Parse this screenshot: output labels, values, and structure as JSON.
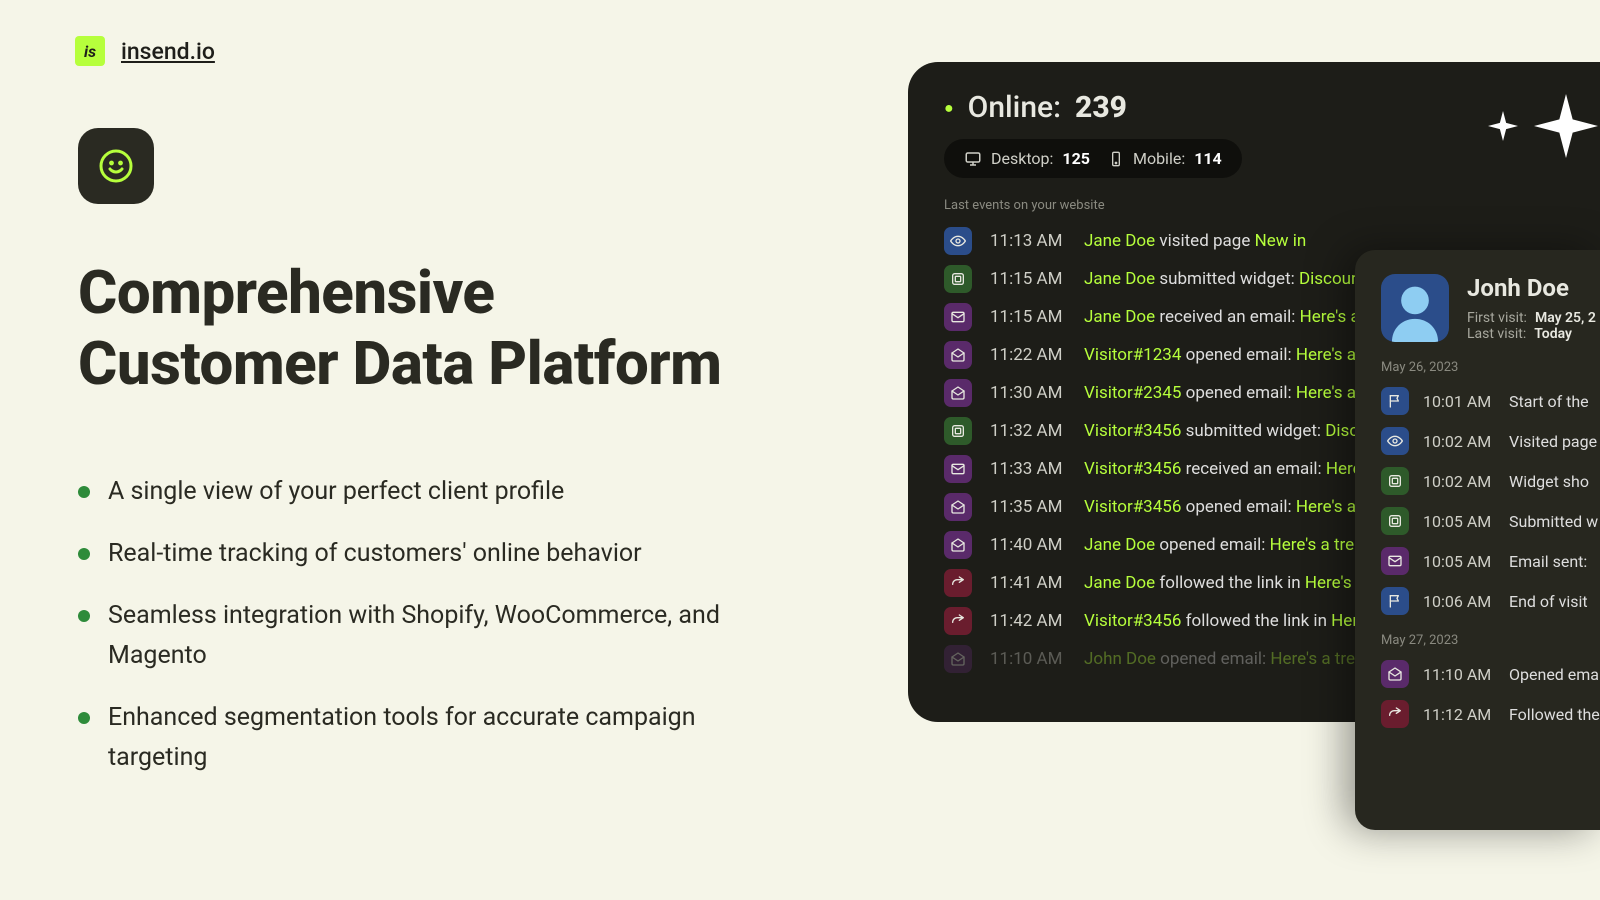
{
  "brand": {
    "logo_text": "is",
    "name": "insend.io"
  },
  "hero": {
    "title_line1": "Comprehensive",
    "title_line2": "Customer Data Platform",
    "bullets": [
      "A single view of your perfect client profile",
      "Real-time tracking of customers' online behavior",
      "Seamless integration with Shopify, WooCommerce, and Magento",
      "Enhanced segmentation tools for accurate campaign targeting"
    ]
  },
  "dashboard": {
    "online_label": "Online:",
    "online_count": "239",
    "device": {
      "desktop_label": "Desktop:",
      "desktop_count": "125",
      "mobile_label": "Mobile:",
      "mobile_count": "114"
    },
    "last_events_label": "Last events on your website",
    "events": [
      {
        "icon": "eye",
        "color": "blue",
        "time": "11:13 AM",
        "who": "Jane Doe",
        "verb": "visited page",
        "obj": "New in"
      },
      {
        "icon": "widget",
        "color": "green",
        "time": "11:15 AM",
        "who": "Jane Doe",
        "verb": "submitted widget:",
        "obj": "Discount"
      },
      {
        "icon": "mail",
        "color": "purple",
        "time": "11:15 AM",
        "who": "Jane Doe",
        "verb": "received an email:",
        "obj": "Here's a"
      },
      {
        "icon": "mailopen",
        "color": "purple",
        "time": "11:22 AM",
        "who": "Visitor#1234",
        "verb": "opened email:",
        "obj": "Here's a"
      },
      {
        "icon": "mailopen",
        "color": "purple",
        "time": "11:30 AM",
        "who": "Visitor#2345",
        "verb": "opened email:",
        "obj": "Here's a"
      },
      {
        "icon": "widget",
        "color": "green",
        "time": "11:32 AM",
        "who": "Visitor#3456",
        "verb": "submitted widget:",
        "obj": "Disc"
      },
      {
        "icon": "mail",
        "color": "purple",
        "time": "11:33 AM",
        "who": "Visitor#3456",
        "verb": "received  an email:",
        "obj": "Here"
      },
      {
        "icon": "mailopen",
        "color": "purple",
        "time": "11:35 AM",
        "who": "Visitor#3456",
        "verb": "opened email:",
        "obj": "Here's a"
      },
      {
        "icon": "mailopen",
        "color": "purple",
        "time": "11:40 AM",
        "who": "Jane Doe",
        "verb": "opened email:",
        "obj": "Here's a trea"
      },
      {
        "icon": "redirect",
        "color": "red",
        "time": "11:41 AM",
        "who": "Jane Doe",
        "verb": "followed the link in",
        "obj": "Here's a"
      },
      {
        "icon": "redirect",
        "color": "red",
        "time": "11:42 AM",
        "who": "Visitor#3456",
        "verb": "followed the link in",
        "obj": "Her"
      },
      {
        "icon": "mailopen",
        "color": "purple",
        "time": "11:10 AM",
        "who": "John Doe",
        "verb": "opened email:",
        "obj": "Here's a tre",
        "faded": true
      }
    ]
  },
  "profile": {
    "name": "Jonh Doe",
    "first_visit_label": "First visit:",
    "first_visit_value": "May 25, 2",
    "last_visit_label": "Last visit:",
    "last_visit_value": "Today",
    "days": [
      {
        "label": "May 26, 2023",
        "events": [
          {
            "icon": "flag",
            "color": "blue",
            "time": "10:01 AM",
            "text": "Start of the"
          },
          {
            "icon": "eye",
            "color": "blue",
            "time": "10:02 AM",
            "text": "Visited page"
          },
          {
            "icon": "widget",
            "color": "green",
            "time": "10:02 AM",
            "text": "Widget sho"
          },
          {
            "icon": "widget",
            "color": "green",
            "time": "10:05 AM",
            "text": "Submitted w"
          },
          {
            "icon": "mail",
            "color": "purple",
            "time": "10:05 AM",
            "text": "Email sent:"
          },
          {
            "icon": "flag",
            "color": "blue",
            "time": "10:06 AM",
            "text": "End of visit"
          }
        ]
      },
      {
        "label": "May 27, 2023",
        "events": [
          {
            "icon": "mailopen",
            "color": "purple",
            "time": "11:10 AM",
            "text": "Opened ema"
          },
          {
            "icon": "redirect",
            "color": "red",
            "time": "11:12 AM",
            "text": "Followed the"
          }
        ]
      }
    ]
  },
  "colors": {
    "accent": "#b6ff3c"
  }
}
